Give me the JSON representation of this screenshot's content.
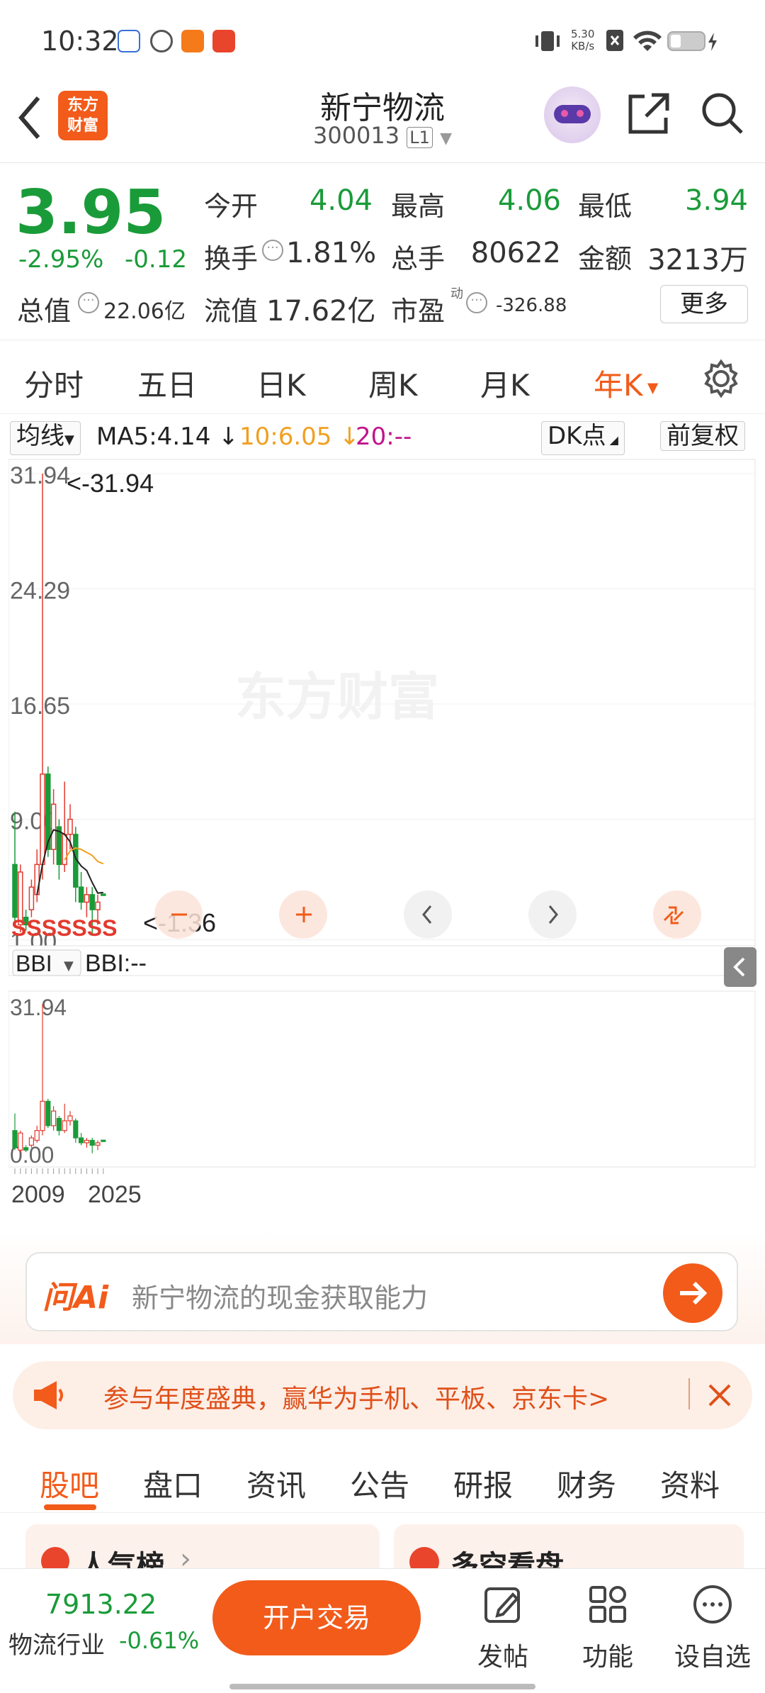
{
  "status": {
    "time": "10:32",
    "net_speed": "5.30",
    "net_unit": "KB/s"
  },
  "header": {
    "logo_line1": "东方",
    "logo_line2": "财富",
    "title": "新宁物流",
    "code": "300013",
    "level": "L1"
  },
  "quote": {
    "price": "3.95",
    "pct": "-2.95%",
    "chg": "-0.12",
    "open_label": "今开",
    "open": "4.04",
    "high_label": "最高",
    "high": "4.06",
    "low_label": "最低",
    "low": "3.94",
    "turnover_label": "换手",
    "turnover": "1.81%",
    "volume_label": "总手",
    "volume": "80622",
    "amount_label": "金额",
    "amount": "3213万",
    "mktcap_label": "总值",
    "mktcap": "22.06亿",
    "float_label": "流值",
    "float": "17.62亿",
    "pe_label": "市盈",
    "pe_sup": "动",
    "pe": "-326.88",
    "more": "更多"
  },
  "ktabs": [
    "分时",
    "五日",
    "日K",
    "周K",
    "月K",
    "年K"
  ],
  "indicator": {
    "ma": "均线",
    "ma5": "MA5:4.14",
    "ma10": "10:6.05",
    "ma20": "20:--",
    "dk": "DK点",
    "fq": "前复权"
  },
  "chart_data": {
    "type": "candlestick",
    "main": {
      "ylim": [
        1.36,
        31.94
      ],
      "y_ticks": [
        "31.94",
        "24.29",
        "16.65",
        "9.00",
        "1.00"
      ],
      "max_label": "<-31.94",
      "min_label": "<-1.36",
      "watermark": "东方财富"
    },
    "sub": {
      "name": "BBI",
      "value": "BBI:--",
      "y_ticks": [
        "31.94",
        "0.00"
      ]
    },
    "x_labels": [
      "2009",
      "2025"
    ],
    "candles": [
      {
        "o": 6.0,
        "c": 2.5,
        "h": 9.5,
        "l": 2.0
      },
      {
        "o": 2.0,
        "c": 5.5,
        "h": 6.0,
        "l": 1.5
      },
      {
        "o": 2.5,
        "c": 2.0,
        "h": 3.0,
        "l": 1.6
      },
      {
        "o": 3.0,
        "c": 4.5,
        "h": 5.0,
        "l": 2.5
      },
      {
        "o": 4.0,
        "c": 6.0,
        "h": 7.0,
        "l": 3.5
      },
      {
        "o": 6.0,
        "c": 12.0,
        "h": 31.94,
        "l": 5.0
      },
      {
        "o": 12.0,
        "c": 7.0,
        "h": 12.5,
        "l": 6.5
      },
      {
        "o": 7.0,
        "c": 10.0,
        "h": 11.0,
        "l": 6.0
      },
      {
        "o": 8.5,
        "c": 6.0,
        "h": 9.0,
        "l": 5.0
      },
      {
        "o": 6.0,
        "c": 8.0,
        "h": 11.5,
        "l": 5.5
      },
      {
        "o": 8.0,
        "c": 9.0,
        "h": 10.0,
        "l": 7.0
      },
      {
        "o": 8.0,
        "c": 4.5,
        "h": 8.5,
        "l": 3.5
      },
      {
        "o": 4.5,
        "c": 3.5,
        "h": 5.5,
        "l": 3.0
      },
      {
        "o": 3.5,
        "c": 4.0,
        "h": 4.5,
        "l": 2.5
      },
      {
        "o": 4.0,
        "c": 3.0,
        "h": 4.5,
        "l": 1.36
      },
      {
        "o": 3.0,
        "c": 3.5,
        "h": 4.0,
        "l": 2.0
      },
      {
        "o": 4.04,
        "c": 3.95,
        "h": 4.06,
        "l": 3.94
      }
    ],
    "ma5": [
      null,
      null,
      null,
      null,
      4.0,
      6.0,
      7.5,
      8.3,
      8.2,
      8.0,
      7.5,
      6.4,
      5.9,
      5.6,
      4.8,
      4.1,
      4.14
    ],
    "ma10": [
      null,
      null,
      null,
      null,
      null,
      null,
      null,
      null,
      null,
      6.3,
      6.9,
      7.1,
      7.0,
      6.8,
      6.6,
      6.2,
      6.05
    ],
    "s_markers": "SSSSSSS"
  },
  "chart_buttons": [
    "minus",
    "plus",
    "prev",
    "next",
    "expand"
  ],
  "ai": {
    "brand": "问Ai",
    "query": "新宁物流的现金获取能力"
  },
  "banner": {
    "text": "参与年度盛典，赢华为手机、平板、京东卡>"
  },
  "tabs": [
    "股吧",
    "盘口",
    "资讯",
    "公告",
    "研报",
    "财务",
    "资料"
  ],
  "cards": [
    {
      "label": "人气榜",
      "chev": "›"
    },
    {
      "label": "多空看盘"
    }
  ],
  "bottom": {
    "index": "7913.22",
    "industry": "物流行业",
    "industry_pct": "-0.61%",
    "trade": "开户交易",
    "post": "发帖",
    "func": "功能",
    "fav": "设自选"
  },
  "colors": {
    "up": "#e23a2e",
    "down": "#1a9b39",
    "accent": "#f25b1a",
    "ma10": "#f0a020",
    "ma20": "#c0148c"
  }
}
